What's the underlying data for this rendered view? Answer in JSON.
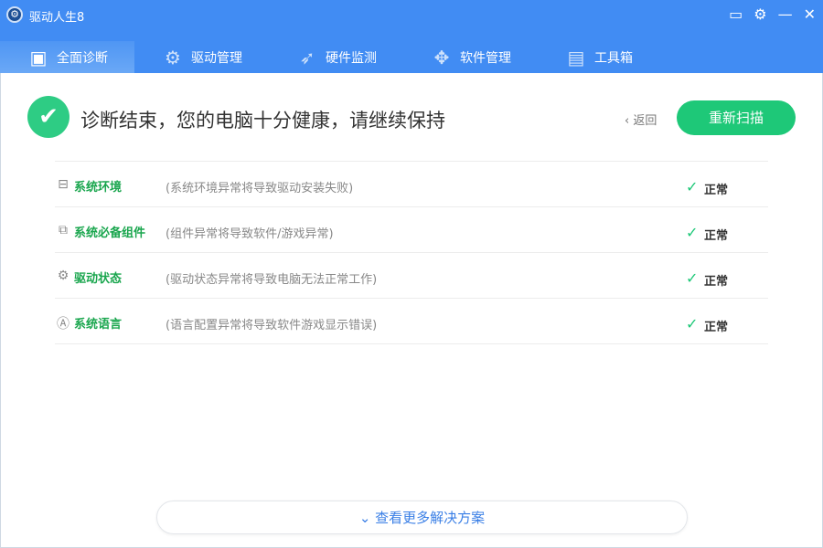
{
  "app": {
    "title": "驱动人生8"
  },
  "tabs": [
    {
      "label": "全面诊断",
      "icon": "monitor-icon"
    },
    {
      "label": "驱动管理",
      "icon": "gear-icon"
    },
    {
      "label": "硬件监测",
      "icon": "rocket-icon"
    },
    {
      "label": "软件管理",
      "icon": "apps-icon"
    },
    {
      "label": "工具箱",
      "icon": "toolbox-icon"
    }
  ],
  "result": {
    "headline": "诊断结束，您的电脑十分健康，请继续保持",
    "back": "返回",
    "rescan": "重新扫描"
  },
  "items": [
    {
      "name": "系统环境",
      "desc": "(系统环境异常将导致驱动安装失败)",
      "status": "正常"
    },
    {
      "name": "系统必备组件",
      "desc": "(组件异常将导致软件/游戏异常)",
      "status": "正常"
    },
    {
      "name": "驱动状态",
      "desc": "(驱动状态异常将导致电脑无法正常工作)",
      "status": "正常"
    },
    {
      "name": "系统语言",
      "desc": "(语言配置异常将导致软件游戏显示错误)",
      "status": "正常"
    }
  ],
  "more": "查看更多解决方案",
  "colors": {
    "brand": "#418cf3",
    "ok": "#1ec878"
  }
}
